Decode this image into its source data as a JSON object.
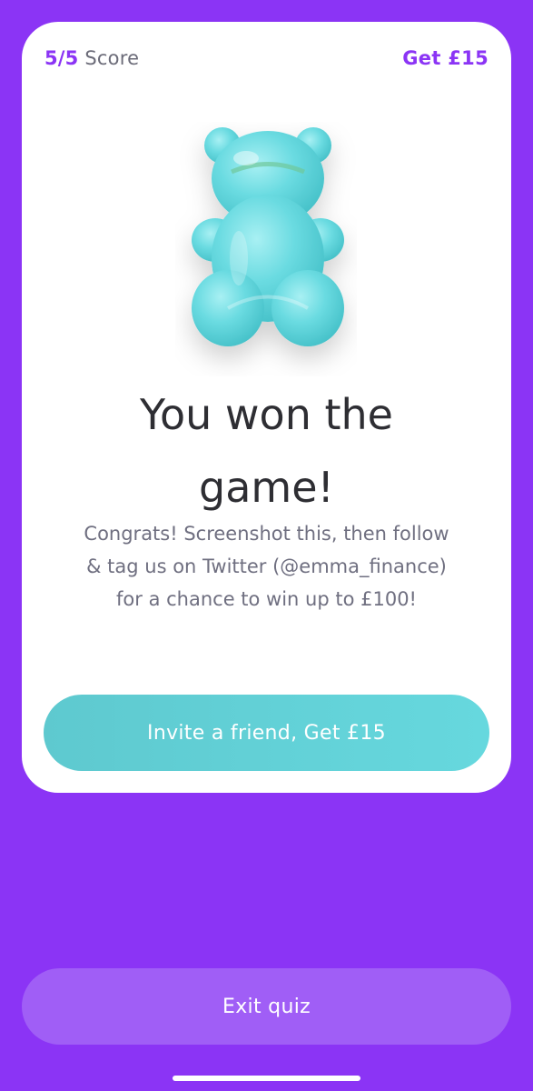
{
  "header": {
    "score_value": "5/5",
    "score_label": "Score",
    "reward_label": "Get £15"
  },
  "illustration": {
    "icon": "gummy-bear-icon",
    "color": "#5fd3da"
  },
  "result": {
    "headline_line1": "You won the",
    "headline_line2": "game!",
    "body_line1": "Congrats! Screenshot this, then follow",
    "body_line2": "& tag us on Twitter (@emma_finance)",
    "body_line3": "for a chance to win up to  £100!"
  },
  "actions": {
    "invite_label": "Invite a friend, Get £15",
    "exit_label": "Exit quiz"
  },
  "colors": {
    "background": "#8b34f5",
    "accent": "#8b34f5",
    "invite_button": "#5ec9cf",
    "exit_button": "#a05ef6"
  }
}
